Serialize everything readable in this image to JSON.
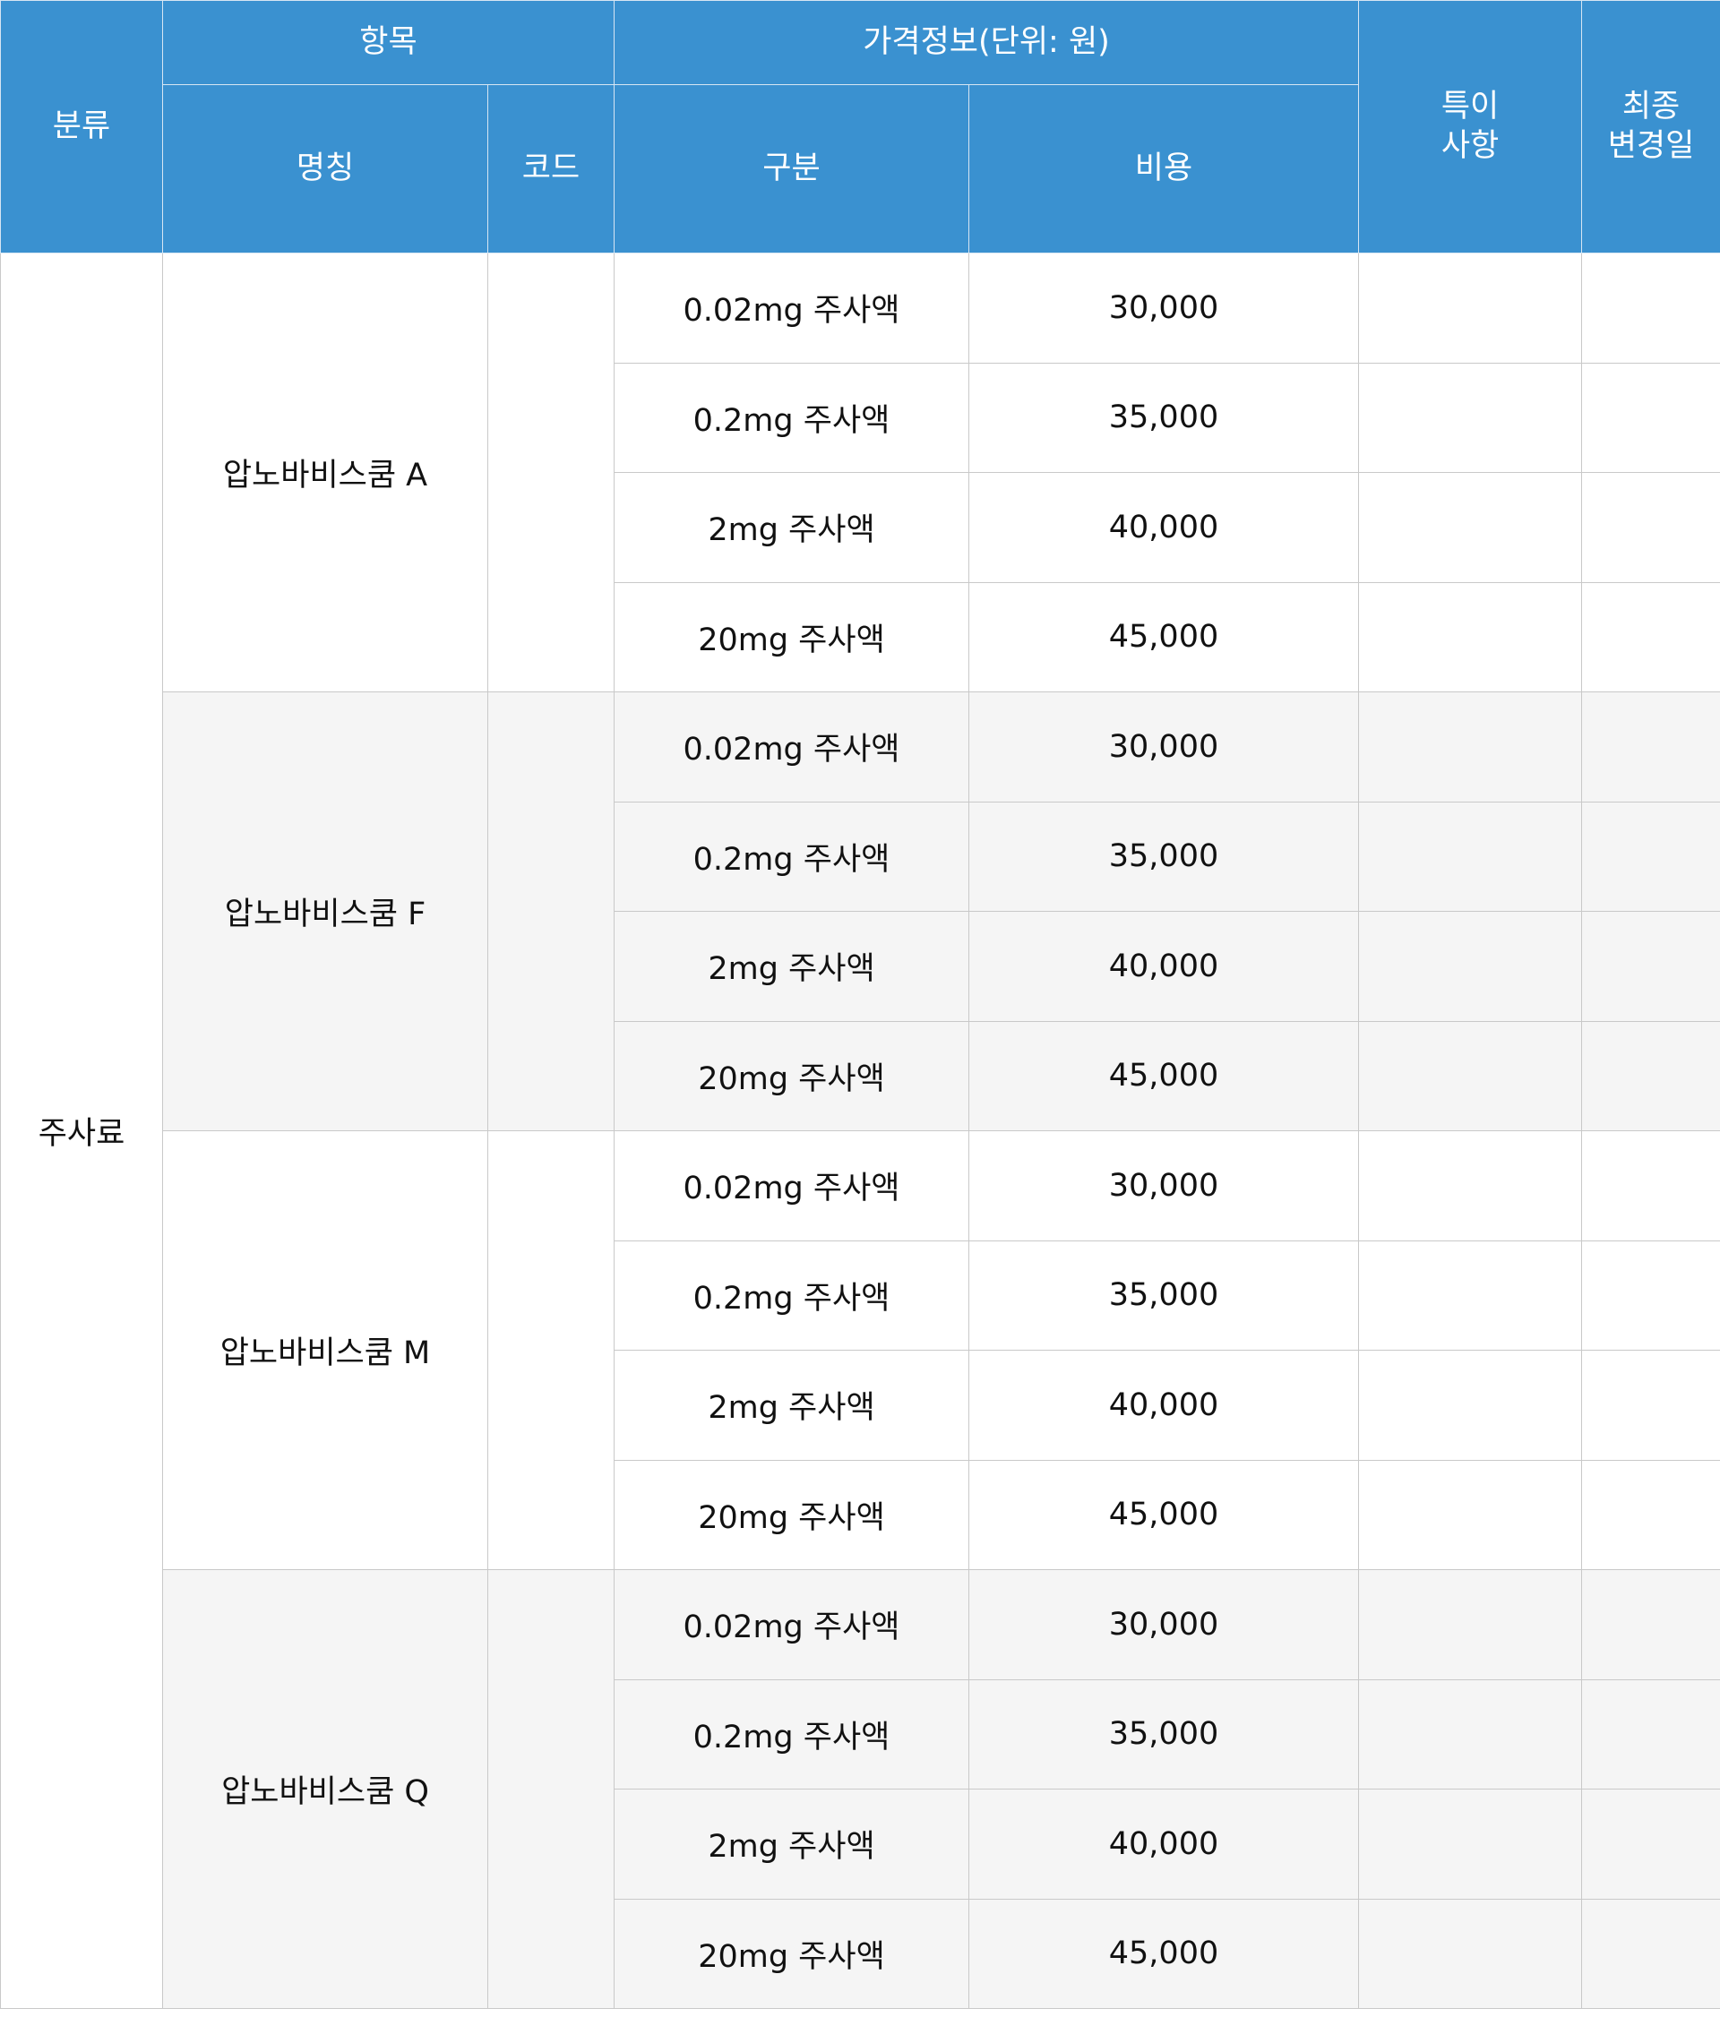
{
  "header": {
    "category": "분류",
    "item_group": "항목",
    "price_group": "가격정보(단위: 원)",
    "notes": "특이 사항",
    "notes_lines": [
      "특이",
      "사항"
    ],
    "last_modified_lines": [
      "최종",
      "변경일"
    ],
    "name": "명칭",
    "code": "코드",
    "division": "구분",
    "cost": "비용"
  },
  "category_label": "주사료",
  "groups": [
    {
      "name": "압노바비스쿰 A",
      "code": "",
      "shade": "white",
      "rows": [
        {
          "division": "0.02mg 주사액",
          "cost": "30,000",
          "notes": "",
          "last_modified": ""
        },
        {
          "division": "0.2mg 주사액",
          "cost": "35,000",
          "notes": "",
          "last_modified": ""
        },
        {
          "division": "2mg 주사액",
          "cost": "40,000",
          "notes": "",
          "last_modified": ""
        },
        {
          "division": "20mg 주사액",
          "cost": "45,000",
          "notes": "",
          "last_modified": ""
        }
      ]
    },
    {
      "name": "압노바비스쿰 F",
      "code": "",
      "shade": "gray",
      "rows": [
        {
          "division": "0.02mg 주사액",
          "cost": "30,000",
          "notes": "",
          "last_modified": ""
        },
        {
          "division": "0.2mg 주사액",
          "cost": "35,000",
          "notes": "",
          "last_modified": ""
        },
        {
          "division": "2mg 주사액",
          "cost": "40,000",
          "notes": "",
          "last_modified": ""
        },
        {
          "division": "20mg 주사액",
          "cost": "45,000",
          "notes": "",
          "last_modified": ""
        }
      ]
    },
    {
      "name": "압노바비스쿰 M",
      "code": "",
      "shade": "white",
      "rows": [
        {
          "division": "0.02mg 주사액",
          "cost": "30,000",
          "notes": "",
          "last_modified": ""
        },
        {
          "division": "0.2mg 주사액",
          "cost": "35,000",
          "notes": "",
          "last_modified": ""
        },
        {
          "division": "2mg 주사액",
          "cost": "40,000",
          "notes": "",
          "last_modified": ""
        },
        {
          "division": "20mg 주사액",
          "cost": "45,000",
          "notes": "",
          "last_modified": ""
        }
      ]
    },
    {
      "name": "압노바비스쿰 Q",
      "code": "",
      "shade": "gray",
      "rows": [
        {
          "division": "0.02mg 주사액",
          "cost": "30,000",
          "notes": "",
          "last_modified": ""
        },
        {
          "division": "0.2mg 주사액",
          "cost": "35,000",
          "notes": "",
          "last_modified": ""
        },
        {
          "division": "2mg 주사액",
          "cost": "40,000",
          "notes": "",
          "last_modified": ""
        },
        {
          "division": "20mg 주사액",
          "cost": "45,000",
          "notes": "",
          "last_modified": ""
        }
      ]
    }
  ],
  "colors": {
    "header_bg": "#3a91d0",
    "header_text": "#ffffff",
    "alt_row_bg": "#f5f5f5",
    "grid_line": "#c9c9c9"
  }
}
